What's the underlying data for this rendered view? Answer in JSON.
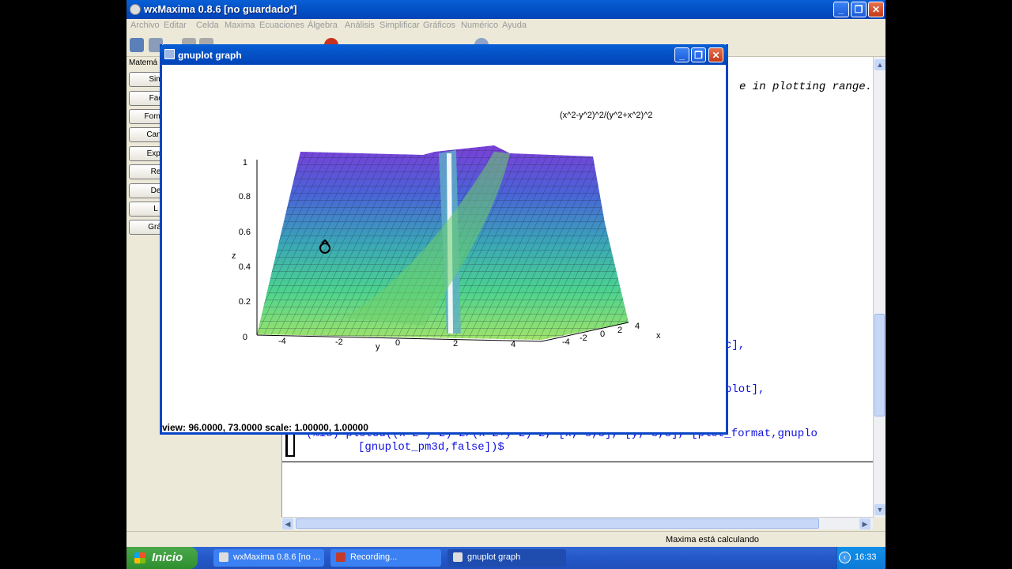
{
  "main_window": {
    "title": "wxMaxima 0.8.6 [no guardado*]",
    "menu": [
      "Archivo",
      "Editar",
      "Celda",
      "Maxima",
      "Ecuaciones",
      "Álgebra",
      "Análisis",
      "Simplificar",
      "Gráficos",
      "Numérico",
      "Ayuda"
    ],
    "side_panel": {
      "header": "Matemá",
      "buttons": [
        "Sim",
        "Fac",
        "Forma",
        "Canc",
        "Expa",
        "Re",
        "De",
        "L",
        "Gráf"
      ]
    },
    "document": {
      "line_warning": "e in plotting range.",
      "line_c": "c],",
      "line_plot": "plot],",
      "input_line_1": "(%i8) plot3d((x^2-y^2)^2/(x^2+y^2)^2, [x,-5,5], [y,-5,5], [plot_format,gnuplo",
      "input_line_2": "[gnuplot_pm3d,false])$"
    },
    "status_text": "Maxima está calculando"
  },
  "gnuplot_window": {
    "title": "gnuplot graph",
    "status": "view:  96.0000,  73.0000   scale:  1.00000,  1.00000"
  },
  "chart_data": {
    "type": "surface3d",
    "function_label": "(x^2-y^2)^2/(y^2+x^2)^2",
    "zlabel": "z",
    "ylabel": "y",
    "xlabel": "x",
    "z_ticks": [
      "0",
      "0.2",
      "0.4",
      "0.6",
      "0.8",
      "1"
    ],
    "y_ticks": [
      "-4",
      "-2",
      "0",
      "2",
      "4"
    ],
    "x_ticks": [
      "-4",
      "-2",
      "0",
      "2",
      "4"
    ],
    "zlim": [
      0,
      1
    ]
  },
  "taskbar": {
    "start_label": "Inicio",
    "tasks": [
      "wxMaxima 0.8.6 [no ...",
      "Recording...",
      "gnuplot graph"
    ],
    "clock": "16:33"
  }
}
